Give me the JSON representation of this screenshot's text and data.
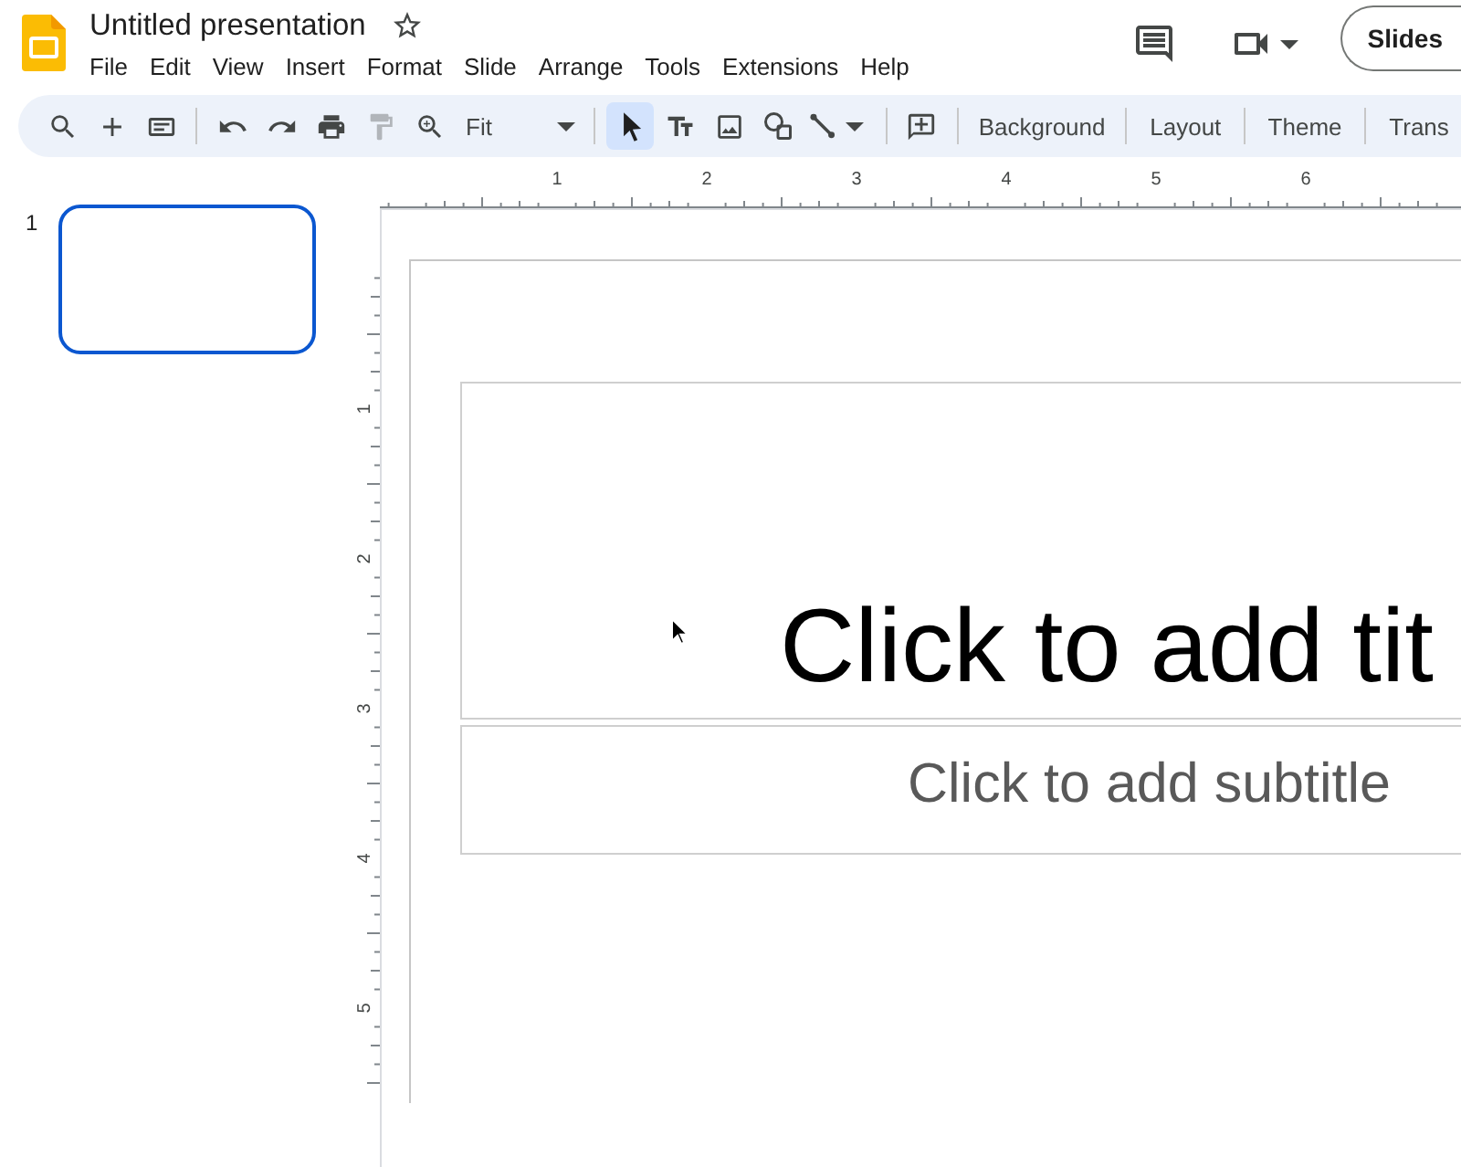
{
  "app": {
    "title": "Untitled presentation",
    "starred": false
  },
  "menu": [
    "File",
    "Edit",
    "View",
    "Insert",
    "Format",
    "Slide",
    "Arrange",
    "Tools",
    "Extensions",
    "Help"
  ],
  "header_actions": {
    "slideshow_button": "Slides"
  },
  "toolbar": {
    "groups": [
      [
        {
          "kind": "search",
          "selected": false,
          "disabled": false
        },
        {
          "kind": "insert",
          "selected": false,
          "disabled": false
        },
        {
          "kind": "new-slide",
          "selected": false,
          "disabled": false
        }
      ],
      [
        {
          "kind": "undo",
          "selected": false,
          "disabled": false
        },
        {
          "kind": "redo",
          "selected": false,
          "disabled": false
        },
        {
          "kind": "print",
          "selected": false,
          "disabled": false
        },
        {
          "kind": "paint-format",
          "selected": false,
          "disabled": true
        },
        {
          "kind": "zoom",
          "selected": false,
          "disabled": false
        },
        {
          "kind": "dropdown",
          "value": "Fit",
          "selected": false,
          "disabled": false
        }
      ],
      [
        {
          "kind": "select",
          "selected": true,
          "disabled": false
        },
        {
          "kind": "text-box",
          "selected": false,
          "disabled": false
        },
        {
          "kind": "image",
          "selected": false,
          "disabled": false
        },
        {
          "kind": "shape",
          "selected": false,
          "disabled": false
        },
        {
          "kind": "line",
          "selected": false,
          "disabled": false
        }
      ],
      [
        {
          "kind": "comment",
          "selected": false,
          "disabled": false
        }
      ],
      [
        {
          "kind": "text",
          "label": "Background",
          "selected": false,
          "disabled": false
        }
      ],
      [
        {
          "kind": "text",
          "label": "Layout",
          "selected": false,
          "disabled": false
        }
      ],
      [
        {
          "kind": "text",
          "label": "Theme",
          "selected": false,
          "disabled": false
        }
      ],
      [
        {
          "kind": "text",
          "label": "Trans",
          "selected": false,
          "disabled": false
        }
      ]
    ]
  },
  "slides": [
    {
      "number": "1",
      "selected": true
    }
  ],
  "rulers": {
    "horizontal": [
      "1",
      "2",
      "3",
      "4",
      "5",
      "6"
    ],
    "vertical": [
      "1",
      "2",
      "3",
      "4",
      "5"
    ]
  },
  "slide": {
    "title_placeholder": "Click to add tit",
    "subtitle_placeholder": "Click to add subtitle"
  }
}
